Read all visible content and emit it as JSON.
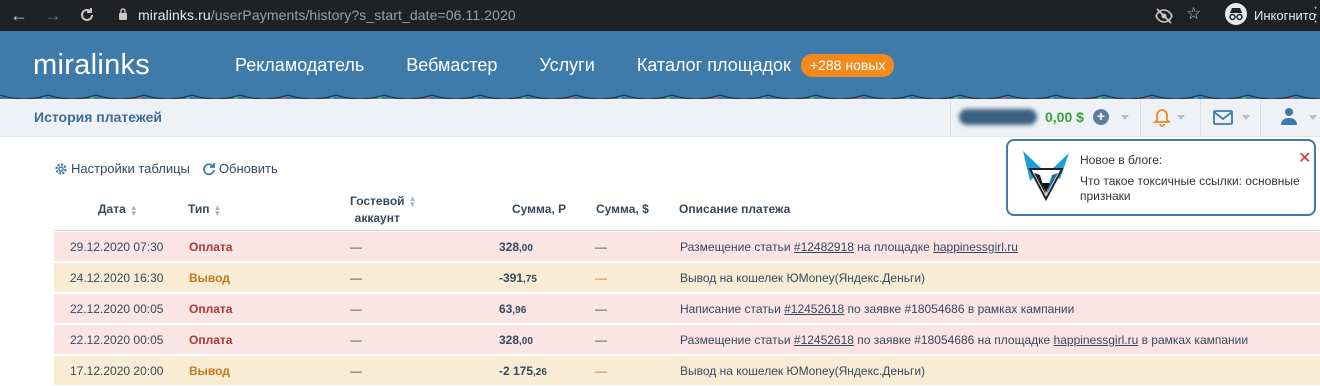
{
  "browser": {
    "url_host": "miralinks.ru",
    "url_path": "/userPayments/history?s_start_date=06.11.2020",
    "incognito_label": "Инкогнито"
  },
  "header": {
    "logo": "miralinks",
    "nav": [
      "Рекламодатель",
      "Вебмастер",
      "Услуги",
      "Каталог площадок"
    ],
    "new_badge": "+288 новых"
  },
  "subbar": {
    "page_title": "История платежей",
    "balance_usd": "0,00 $"
  },
  "toolbar": {
    "settings_label": "Настройки таблицы",
    "refresh_label": "Обновить"
  },
  "notification": {
    "title": "Новое в блоге:",
    "text": "Что такое токсичные ссылки: основные признаки",
    "close": "✕"
  },
  "table": {
    "headers": {
      "date": "Дата",
      "type": "Тип",
      "guest_line1": "Гостевой",
      "guest_line2": "аккаунт",
      "sum_rub": "Сумма, Р",
      "sum_usd": "Сумма, $",
      "desc": "Описание платежа"
    },
    "rows": [
      {
        "kind": "pay",
        "date": "29.12.2020 07:30",
        "type": "Оплата",
        "guest": "—",
        "sum_int": "328",
        "sum_frac": ",00",
        "usd": "—",
        "desc_pre": "Размещение статьи ",
        "link1": "#12482918",
        "desc_mid": " на площадке ",
        "link2": "happinessgirl.ru",
        "desc_post": ""
      },
      {
        "kind": "out",
        "date": "24.12.2020 16:30",
        "type": "Вывод",
        "guest": "—",
        "sum_int": "-391",
        "sum_frac": ",75",
        "usd": "—",
        "desc_pre": "Вывод на кошелек ЮMoney(Яндекс.Деньги)",
        "link1": "",
        "desc_mid": "",
        "link2": "",
        "desc_post": ""
      },
      {
        "kind": "pay",
        "date": "22.12.2020 00:05",
        "type": "Оплата",
        "guest": "—",
        "sum_int": "63",
        "sum_frac": ",96",
        "usd": "—",
        "desc_pre": "Написание статьи ",
        "link1": "#12452618",
        "desc_mid": " по заявке #18054686 в рамках кампании",
        "link2": "",
        "desc_post": ""
      },
      {
        "kind": "pay",
        "date": "22.12.2020 00:05",
        "type": "Оплата",
        "guest": "—",
        "sum_int": "328",
        "sum_frac": ",00",
        "usd": "—",
        "desc_pre": "Размещение статьи ",
        "link1": "#12452618",
        "desc_mid": " по заявке #18054686 на площадке ",
        "link2": "happinessgirl.ru",
        "desc_post": " в рамках кампании"
      },
      {
        "kind": "out",
        "date": "17.12.2020 20:00",
        "type": "Вывод",
        "guest": "—",
        "sum_int": "-2 175",
        "sum_frac": ",26",
        "usd": "—",
        "desc_pre": "Вывод на кошелек ЮMoney(Яндекс.Деньги)",
        "link1": "",
        "desc_mid": "",
        "link2": "",
        "desc_post": ""
      }
    ]
  },
  "colors": {
    "header_bg": "#3e7bab",
    "badge": "#f28a1d",
    "row_pay": "#fbe4e4",
    "row_out": "#f9ecd5"
  }
}
